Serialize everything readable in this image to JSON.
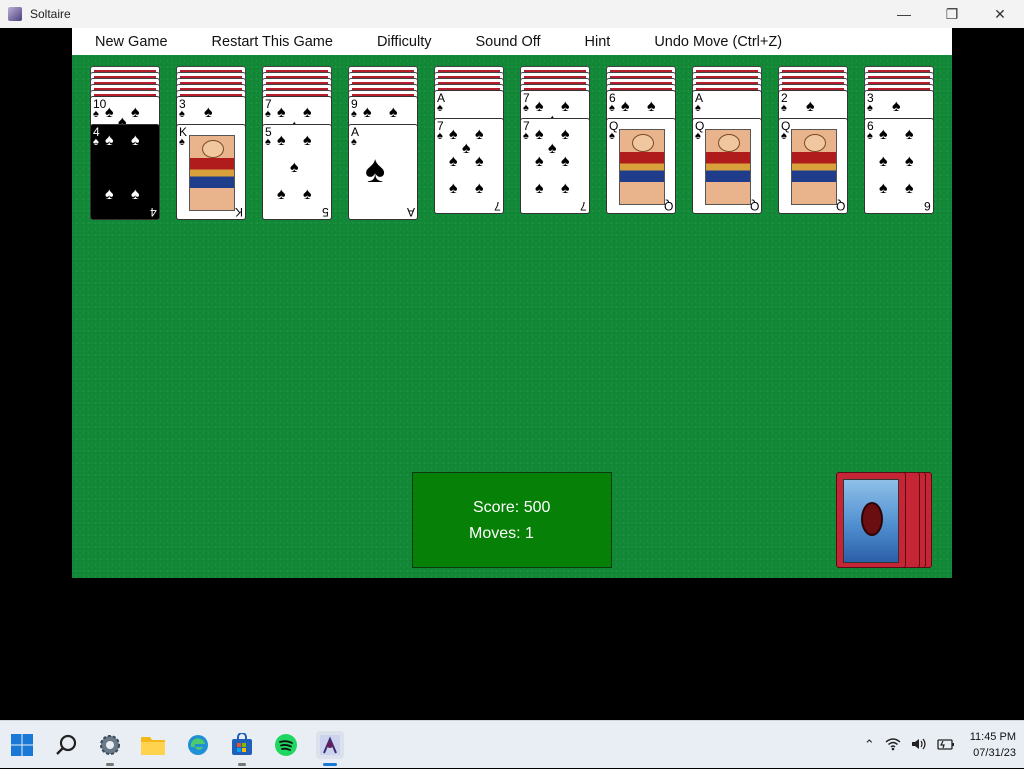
{
  "window": {
    "title": "Soltaire",
    "icon": "spider-app-icon",
    "controls": [
      "minimize-icon",
      "restore-icon",
      "close-icon"
    ]
  },
  "menu": {
    "items": [
      "New Game",
      "Restart This Game",
      "Difficulty",
      "Sound Off",
      "Hint",
      "Undo Move (Ctrl+Z)"
    ]
  },
  "tableau": [
    {
      "hidden": 5,
      "cards": [
        {
          "rank": "10",
          "suit": "♠"
        },
        {
          "rank": "4",
          "suit": "♠",
          "selected": true
        }
      ]
    },
    {
      "hidden": 5,
      "cards": [
        {
          "rank": "3",
          "suit": "♠"
        },
        {
          "rank": "K",
          "suit": "♠",
          "face": true
        }
      ]
    },
    {
      "hidden": 5,
      "cards": [
        {
          "rank": "7",
          "suit": "♠"
        },
        {
          "rank": "5",
          "suit": "♠"
        }
      ]
    },
    {
      "hidden": 5,
      "cards": [
        {
          "rank": "9",
          "suit": "♠"
        },
        {
          "rank": "A",
          "suit": "♠",
          "ace": true
        }
      ]
    },
    {
      "hidden": 4,
      "cards": [
        {
          "rank": "A",
          "suit": "♠"
        },
        {
          "rank": "7",
          "suit": "♠"
        }
      ]
    },
    {
      "hidden": 4,
      "cards": [
        {
          "rank": "7",
          "suit": "♠"
        },
        {
          "rank": "7",
          "suit": "♠"
        }
      ]
    },
    {
      "hidden": 4,
      "cards": [
        {
          "rank": "6",
          "suit": "♠"
        },
        {
          "rank": "Q",
          "suit": "♠",
          "face": true
        }
      ]
    },
    {
      "hidden": 4,
      "cards": [
        {
          "rank": "A",
          "suit": "♠"
        },
        {
          "rank": "Q",
          "suit": "♠",
          "face": true
        }
      ]
    },
    {
      "hidden": 4,
      "cards": [
        {
          "rank": "2",
          "suit": "♠"
        },
        {
          "rank": "Q",
          "suit": "♠",
          "face": true
        }
      ]
    },
    {
      "hidden": 4,
      "cards": [
        {
          "rank": "3",
          "suit": "♠"
        },
        {
          "rank": "6",
          "suit": "♠"
        }
      ]
    }
  ],
  "status": {
    "score_label": "Score: 500",
    "moves_label": "Moves: 1"
  },
  "stock": {
    "piles": 4,
    "art": "spider-web-card-back"
  },
  "taskbar": {
    "apps": [
      "windows-start-icon",
      "search-icon",
      "settings-icon",
      "file-explorer-icon",
      "edge-icon",
      "microsoft-store-icon",
      "spotify-icon",
      "spider-solitaire-icon"
    ],
    "time": "11:45 PM",
    "date": "07/31/23"
  }
}
